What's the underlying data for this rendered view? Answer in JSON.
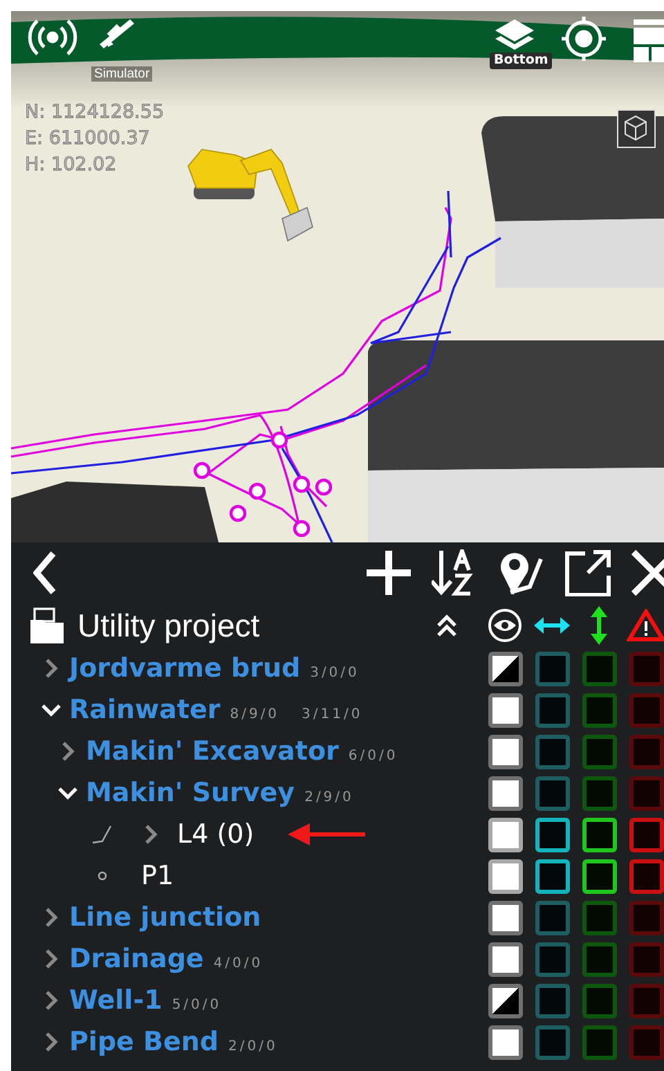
{
  "status_bar": {
    "gps_label": "Simulator",
    "layer_label": "Bottom"
  },
  "coordinates": [
    "N: 1124128.55",
    "E: 611000.37",
    "H: 102.02"
  ],
  "panel": {
    "title": "Utility project"
  },
  "layers": [
    {
      "name": "Jordvarme brud",
      "kind": "group",
      "counts": [
        "3/0/0"
      ],
      "expanded": false,
      "indeterminate": true,
      "active": false,
      "marked": false
    },
    {
      "name": "Rainwater",
      "kind": "group",
      "counts": [
        "8/9/0",
        "3/11/0"
      ],
      "expanded": true,
      "indeterminate": false,
      "active": false,
      "marked": false,
      "children": [
        {
          "name": "Makin' Excavator",
          "kind": "group",
          "counts": [
            "6/0/0"
          ],
          "expanded": false,
          "indeterminate": false,
          "active": false,
          "marked": false
        },
        {
          "name": "Makin' Survey",
          "kind": "group",
          "counts": [
            "2/9/0"
          ],
          "expanded": true,
          "indeterminate": false,
          "active": false,
          "marked": false,
          "children": [
            {
              "name": "L4 (0)",
              "kind": "line",
              "expanded": false,
              "indeterminate": false,
              "active": true,
              "marked": true
            },
            {
              "name": "P1",
              "kind": "point",
              "indeterminate": false,
              "active": true,
              "marked": false
            }
          ]
        }
      ]
    },
    {
      "name": "Line junction",
      "kind": "group",
      "expanded": false,
      "indeterminate": false,
      "active": false,
      "marked": false
    },
    {
      "name": "Drainage",
      "kind": "group",
      "counts": [
        "4/0/0"
      ],
      "expanded": false,
      "indeterminate": false,
      "active": false,
      "marked": false
    },
    {
      "name": "Well-1",
      "kind": "group",
      "counts": [
        "5/0/0"
      ],
      "expanded": false,
      "indeterminate": true,
      "active": false,
      "marked": false
    },
    {
      "name": "Pipe Bend",
      "kind": "group",
      "counts": [
        "2/0/0"
      ],
      "expanded": false,
      "indeterminate": false,
      "active": false,
      "marked": false
    }
  ]
}
